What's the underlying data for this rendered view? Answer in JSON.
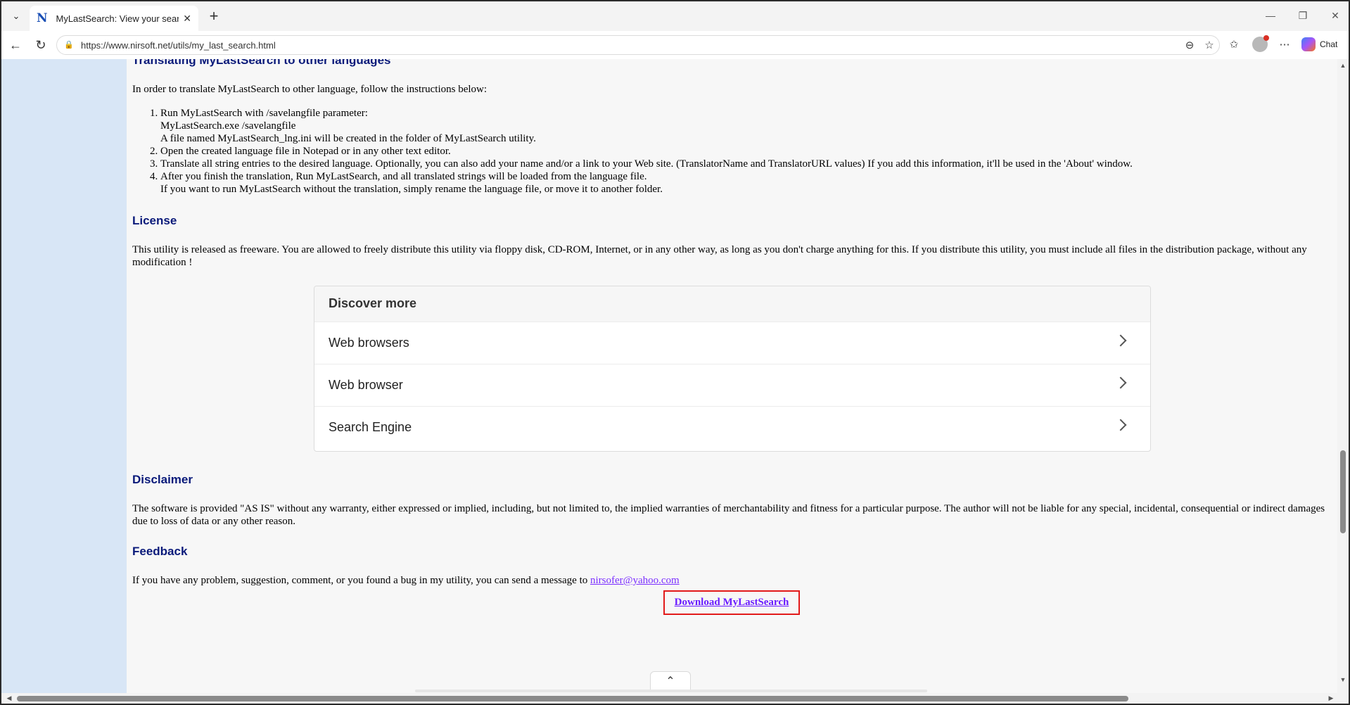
{
  "browser": {
    "tab_title": "MyLastSearch: View your search en",
    "url": "https://www.nirsoft.net/utils/my_last_search.html",
    "chat_label": "Chat",
    "icons": [
      "tab-list-icon",
      "close-icon",
      "new-tab-icon",
      "minimize-icon",
      "restore-icon",
      "back-icon",
      "reload-icon",
      "lock-icon",
      "reader-icon",
      "favorite-star-icon",
      "favorites-icon",
      "profile-icon",
      "more-icon",
      "copilot-icon"
    ]
  },
  "page": {
    "translate_heading": "Translating MyLastSearch to other languages",
    "translate_intro": "In order to translate MyLastSearch to other language, follow the instructions below:",
    "steps": [
      {
        "line1": "Run MyLastSearch with /savelangfile parameter:",
        "line2": "MyLastSearch.exe /savelangfile",
        "line3": "A file named MyLastSearch_lng.ini will be created in the folder of MyLastSearch utility."
      },
      {
        "line1": "Open the created language file in Notepad or in any other text editor."
      },
      {
        "line1": "Translate all string entries to the desired language. Optionally, you can also add your name and/or a link to your Web site. (TranslatorName and TranslatorURL values) If you add this information, it'll be used in the 'About' window."
      },
      {
        "line1": "After you finish the translation, Run MyLastSearch, and all translated strings will be loaded from the language file.",
        "line2": "If you want to run MyLastSearch without the translation, simply rename the language file, or move it to another folder."
      }
    ],
    "license_heading": "License",
    "license_text": "This utility is released as freeware. You are allowed to freely distribute this utility via floppy disk, CD-ROM, Internet, or in any other way, as long as you don't charge anything for this. If you distribute this utility, you must include all files in the distribution package, without any modification !",
    "discover": {
      "title": "Discover more",
      "items": [
        "Web browsers",
        "Web browser",
        "Search Engine"
      ]
    },
    "disclaimer_heading": "Disclaimer",
    "disclaimer_text": "The software is provided \"AS IS\" without any warranty, either expressed or implied, including, but not limited to, the implied warranties of merchantability and fitness for a particular purpose. The author will not be liable for any special, incidental, consequential or indirect damages due to loss of data or any other reason.",
    "feedback_heading": "Feedback",
    "feedback_text": "If you have any problem, suggestion, comment, or you found a bug in my utility, you can send a message to",
    "feedback_email": "nirsofer@yahoo.com",
    "download_label": "Download MyLastSearch"
  },
  "colors": {
    "sidebar": "#d8e6f6",
    "heading": "#0a1a7a",
    "link": "#7b2fff",
    "highlight_box": "#e21a1a"
  }
}
